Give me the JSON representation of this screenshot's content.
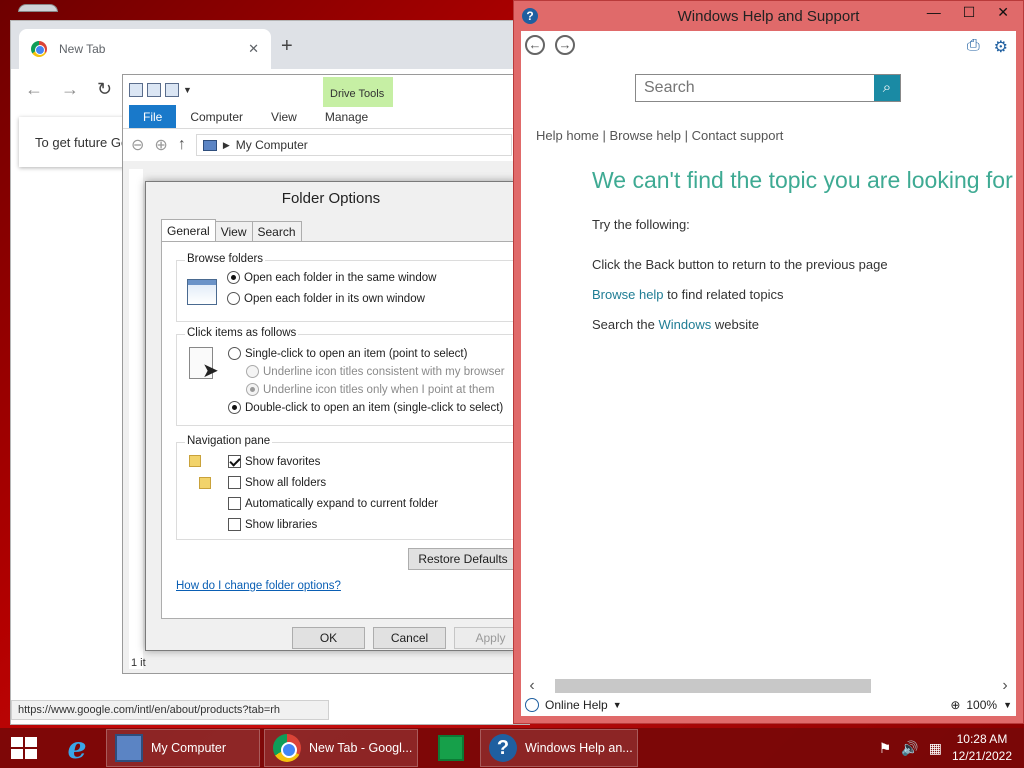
{
  "chrome": {
    "tab_title": "New Tab",
    "notice_text": "To get future Go",
    "status_url": "https://www.google.com/intl/en/about/products?tab=rh"
  },
  "explorer": {
    "contextual_group": "Drive Tools",
    "tabs": [
      "File",
      "Computer",
      "View",
      "Manage"
    ],
    "address": "My Computer",
    "status": "1 it"
  },
  "folder_options": {
    "title": "Folder Options",
    "tabs": [
      "General",
      "View",
      "Search"
    ],
    "browse_folders": {
      "legend": "Browse folders",
      "options": [
        "Open each folder in the same window",
        "Open each folder in its own window"
      ]
    },
    "click_items": {
      "legend": "Click items as follows",
      "single_click": "Single-click to open an item (point to select)",
      "underline_consistent": "Underline icon titles consistent with my browser",
      "underline_point": "Underline icon titles only when I point at them",
      "double_click": "Double-click to open an item (single-click to select)"
    },
    "navigation_pane": {
      "legend": "Navigation pane",
      "options": [
        "Show favorites",
        "Show all folders",
        "Automatically expand to current folder",
        "Show libraries"
      ]
    },
    "restore_defaults": "Restore Defaults",
    "help_link": "How do I change folder options?",
    "ok": "OK",
    "cancel": "Cancel",
    "apply": "Apply"
  },
  "help": {
    "title": "Windows Help and Support",
    "search_placeholder": "Search",
    "crumbs": "Help home | Browse help | Contact support",
    "headline": "We can't find the topic you are looking for",
    "try_following": "Try the following:",
    "back_line": "Click the Back button to return to the previous page",
    "browse_link": "Browse help",
    "browse_rest": " to find related topics",
    "search_pre": "Search the ",
    "windows_link": "Windows",
    "search_post": " website",
    "online_help": "Online Help",
    "zoom": "100%"
  },
  "taskbar": {
    "tasks": [
      "My Computer",
      "New Tab - Googl...",
      "Windows Help an..."
    ],
    "time": "10:28 AM",
    "date": "12/21/2022"
  },
  "colors": {
    "accent_teal": "#3eaa93",
    "link_blue": "#1f7d94",
    "taskbar_red": "#780808"
  }
}
